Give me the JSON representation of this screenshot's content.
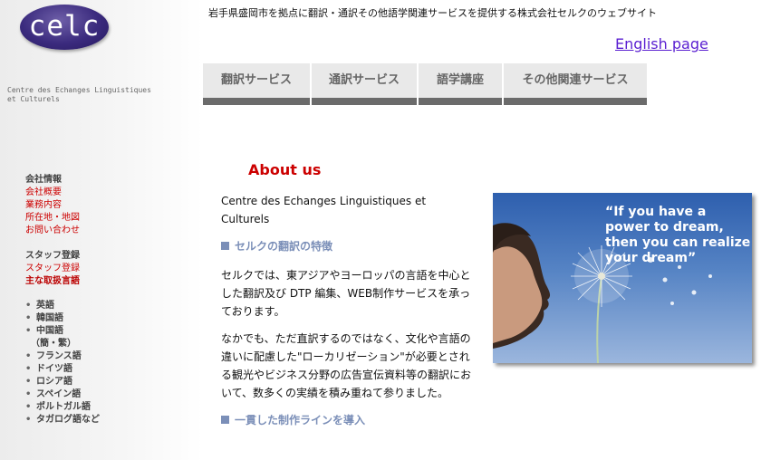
{
  "logo": {
    "text": "celc",
    "subtitle": "Centre des Echanges Linguistiques et Culturels"
  },
  "header": {
    "tagline": "岩手県盛岡市を拠点に翻訳・通訳その他語学関連サービスを提供する株式会社セルクのウェブサイト",
    "english_link": "English page"
  },
  "nav": {
    "tabs": [
      {
        "label": "翻訳サービス"
      },
      {
        "label": "通訳サービス"
      },
      {
        "label": "語学講座"
      },
      {
        "label": "その他関連サービス"
      }
    ]
  },
  "sidebar": {
    "company_heading": "会社情報",
    "company_links": [
      "会社概要",
      "業務内容",
      "所在地・地図",
      "お問い合わせ"
    ],
    "staff_heading": "スタッフ登録",
    "staff_links": [
      "スタッフ登録",
      "主な取扱言語"
    ],
    "languages": [
      "英語",
      "韓国語",
      "中国語",
      "（簡・繁）",
      "フランス語",
      "ドイツ語",
      "ロシア語",
      "スペイン語",
      "ポルトガル語",
      "タガログ語など"
    ]
  },
  "main": {
    "heading": "About us",
    "intro": "Centre des Echanges Linguistiques et Culturels",
    "section1_title": "セルクの翻訳の特徴",
    "para1": "セルクでは、東アジアやヨーロッパの言語を中心とした翻訳及び DTP 編集、WEB制作サービスを承っております。",
    "para2": "なかでも、ただ直訳するのではなく、文化や言語の違いに配慮した\"ローカリゼーション\"が必要とされる観光やビジネス分野の広告宣伝資料等の翻訳において、数多くの実績を積み重ねて参りました。",
    "section2_title": "一貫した制作ラインを導入"
  },
  "photo": {
    "quote": "“If you have a power to dream, then you can realize your dream”"
  },
  "colors": {
    "accent_red": "#cc0000",
    "link_purple": "#5a1fd1",
    "section_blue": "#7b8fb8",
    "logo_purple": "#3b2b7e",
    "tab_bar": "#6b6b6b"
  }
}
